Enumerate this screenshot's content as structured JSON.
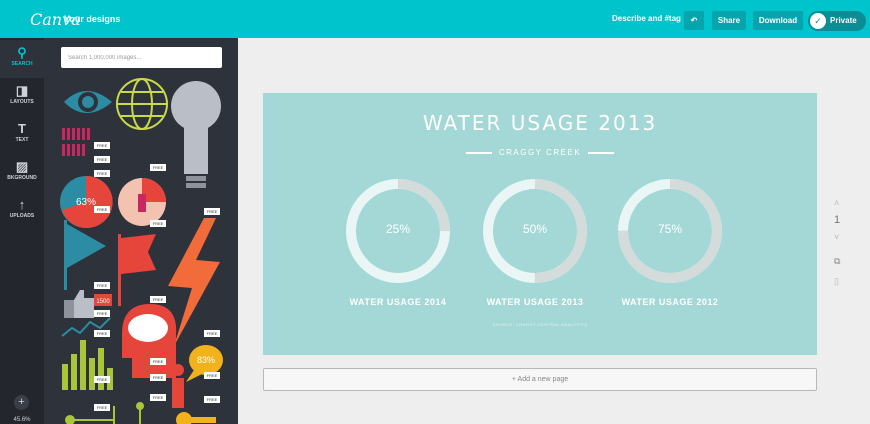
{
  "header": {
    "logo": "Canva",
    "your_designs": "Your designs",
    "describe": "Describe and #tag",
    "undo_icon": "undo-icon",
    "share": "Share",
    "download": "Download",
    "privacy": "Private"
  },
  "sidebar": {
    "items": [
      {
        "label": "SEARCH",
        "icon": "search-icon"
      },
      {
        "label": "LAYOUTS",
        "icon": "layouts-icon"
      },
      {
        "label": "TEXT",
        "icon": "text-icon"
      },
      {
        "label": "BKGROUND",
        "icon": "background-icon"
      },
      {
        "label": "UPLOADS",
        "icon": "upload-icon"
      }
    ],
    "zoom": "45.6%"
  },
  "panel": {
    "search_placeholder": "Search 1,000,000 images...",
    "free_badge": "FREE",
    "graphic_texts": {
      "pct_63": "63%",
      "pct_83": "83%",
      "likes": "1500"
    }
  },
  "design": {
    "title": "WATER USAGE 2013",
    "subtitle": "CRAGGY CREEK",
    "rings": [
      {
        "percent": "25%",
        "label": "WATER USAGE 2014",
        "fill": 0.25
      },
      {
        "percent": "50%",
        "label": "WATER USAGE 2013",
        "fill": 0.5
      },
      {
        "percent": "75%",
        "label": "WATER USAGE 2012",
        "fill": 0.75
      }
    ],
    "source": "SOURCE: CRAGGY CENTRAL ANALYTICS",
    "background": "#a3d8d6"
  },
  "page_tools": {
    "page_number": "1"
  },
  "add_page": "+ Add a new page",
  "colors": {
    "brand": "#00c4cc",
    "rail": "#23262d",
    "panel": "#2e323a"
  }
}
